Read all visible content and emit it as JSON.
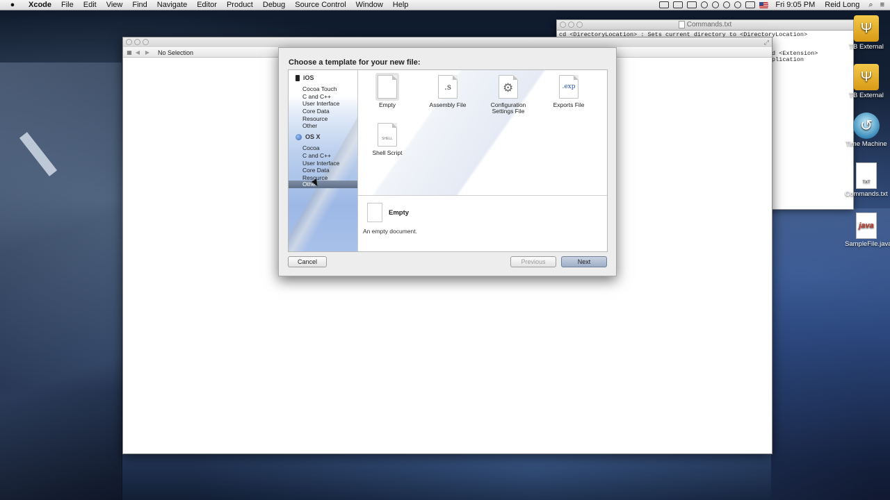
{
  "menubar": {
    "apple": "",
    "app_name": "Xcode",
    "menus": [
      "File",
      "Edit",
      "View",
      "Find",
      "Navigate",
      "Editor",
      "Product",
      "Debug",
      "Source Control",
      "Window",
      "Help"
    ],
    "clock": "Fri 9:05 PM",
    "user": "Reid Long"
  },
  "text_window": {
    "title": "Commands.txt",
    "lines": [
      "cd <DirectoryLocation> : Sets current directory to <DirectoryLocation>",
      "",
      "",
      "                                                          and <Extension>",
      "                                                          application"
    ]
  },
  "desktop_icons": [
    {
      "label": "TB External"
    },
    {
      "label": "TB External"
    },
    {
      "label": "Time Machine"
    },
    {
      "label": "Commands.txt",
      "glyph": "TXT"
    },
    {
      "label": "SampleFile.java",
      "glyph": "java"
    }
  ],
  "xcode": {
    "jumpbar_text": "No Selection"
  },
  "sheet": {
    "heading": "Choose a template for your new file:",
    "groups": [
      {
        "name": "iOS",
        "categories": [
          "Cocoa Touch",
          "C and C++",
          "User Interface",
          "Core Data",
          "Resource",
          "Other"
        ]
      },
      {
        "name": "OS X",
        "categories": [
          "Cocoa",
          "C and C++",
          "User Interface",
          "Core Data",
          "Resource",
          "Other"
        ]
      }
    ],
    "selected_category": "OS X / Other",
    "templates": [
      {
        "name": "Empty",
        "glyph": ""
      },
      {
        "name": "Assembly File",
        "glyph": ".s"
      },
      {
        "name": "Configuration Settings File",
        "glyph": ""
      },
      {
        "name": "Exports File",
        "glyph": ".exp"
      },
      {
        "name": "Shell Script",
        "glyph": "SHELL"
      }
    ],
    "selected_template": "Empty",
    "details": {
      "title": "Empty",
      "description": "An empty document."
    },
    "buttons": {
      "cancel": "Cancel",
      "previous": "Previous",
      "next": "Next"
    }
  }
}
